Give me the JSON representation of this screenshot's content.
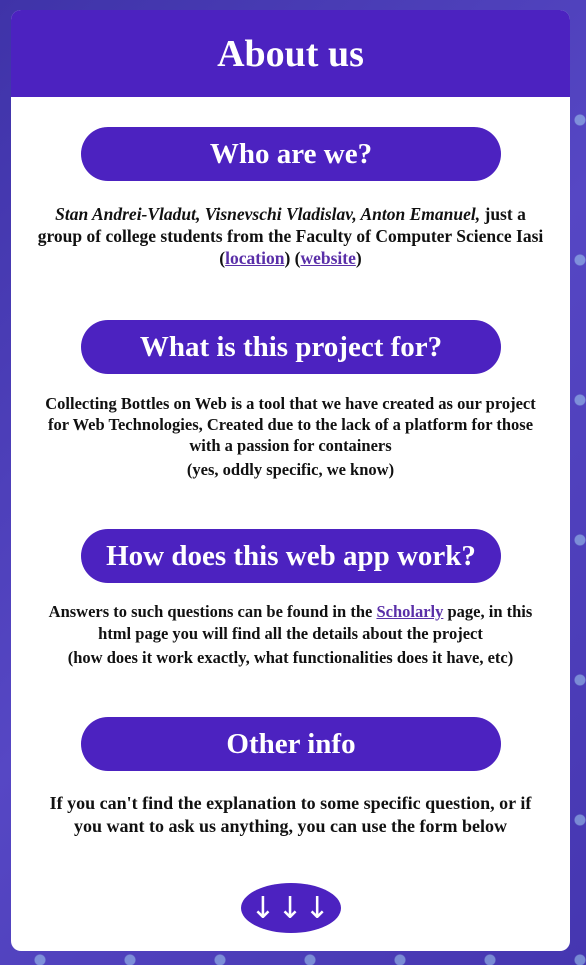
{
  "header": {
    "title": "About us"
  },
  "sections": [
    {
      "heading": "Who are we?",
      "names": "Stan Andrei-Vladut, Visnevschi Vladislav, Anton Emanuel,",
      "text_before": "just a group of college students from the Faculty of Computer Science Iasi (",
      "link1": "location",
      "text_mid": ") (",
      "link2": "website",
      "text_after": ")"
    },
    {
      "heading": "What is this project for?",
      "text": "Collecting Bottles on Web is a tool that we have created as our project for Web Technologies, Created due to the lack of a platform for those with a passion for containers",
      "note": "(yes, oddly specific, we know)"
    },
    {
      "heading": "How does this web app work?",
      "text_before": "Answers to such questions can be found in the ",
      "link": "Scholarly",
      "text_after": " page, in this html page you will find all the details about the project",
      "note": "(how does it work exactly, what functionalities does it have, etc)"
    },
    {
      "heading": "Other info",
      "text": "If you can't find the explanation to some specific question, or if you want to ask us anything, you can use the form below"
    }
  ],
  "scroll_button": {
    "label": "↓↓↓"
  },
  "colors": {
    "accent": "#4c22c0",
    "link": "#5a2fa8",
    "card": "#ffffff"
  }
}
